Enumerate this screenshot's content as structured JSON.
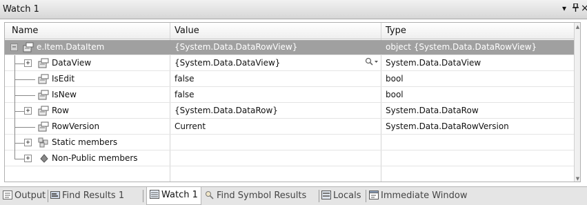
{
  "window": {
    "title": "Watch 1",
    "dropdown_glyph": "▾",
    "pin_glyph": "q",
    "close_glyph": "×"
  },
  "columns": [
    "Name",
    "Value",
    "Type"
  ],
  "rows": [
    {
      "name": "e.Item.DataItem",
      "value": "{System.Data.DataRowView}",
      "type": "object {System.Data.DataRowView}",
      "expander": "−",
      "icon": "property-icon",
      "selected": true
    },
    {
      "name": "DataView",
      "value": "{System.Data.DataView}",
      "type": "System.Data.DataView",
      "expander": "+",
      "icon": "property-icon",
      "has_visualizer": true
    },
    {
      "name": "IsEdit",
      "value": "false",
      "type": "bool",
      "expander": "",
      "icon": "property-icon"
    },
    {
      "name": "IsNew",
      "value": "false",
      "type": "bool",
      "expander": "",
      "icon": "property-icon"
    },
    {
      "name": "Row",
      "value": "{System.Data.DataRow}",
      "type": "System.Data.DataRow",
      "expander": "+",
      "icon": "property-icon"
    },
    {
      "name": "RowVersion",
      "value": "Current",
      "type": "System.Data.DataRowVersion",
      "expander": "",
      "icon": "property-icon"
    },
    {
      "name": "Static members",
      "value": "",
      "type": "",
      "expander": "+",
      "icon": "static-members-icon"
    },
    {
      "name": "Non-Public members",
      "value": "",
      "type": "",
      "expander": "+",
      "icon": "non-public-icon"
    }
  ],
  "visualizer": {
    "glyph": "🔍▾"
  },
  "tabs": [
    {
      "label": "Output",
      "icon": "output-icon",
      "active": false
    },
    {
      "label": "Find Results 1",
      "icon": "find-results-icon",
      "active": false
    },
    {
      "label": "Watch 1",
      "icon": "watch-icon",
      "active": true
    },
    {
      "label": "Find Symbol Results",
      "icon": "find-symbol-icon",
      "active": false
    },
    {
      "label": "Locals",
      "icon": "locals-icon",
      "active": false
    },
    {
      "label": "Immediate Window",
      "icon": "immediate-window-icon",
      "active": false
    }
  ],
  "colors": {
    "selected_row": "#a0a0a0",
    "grid_line": "#d4d4d4"
  }
}
